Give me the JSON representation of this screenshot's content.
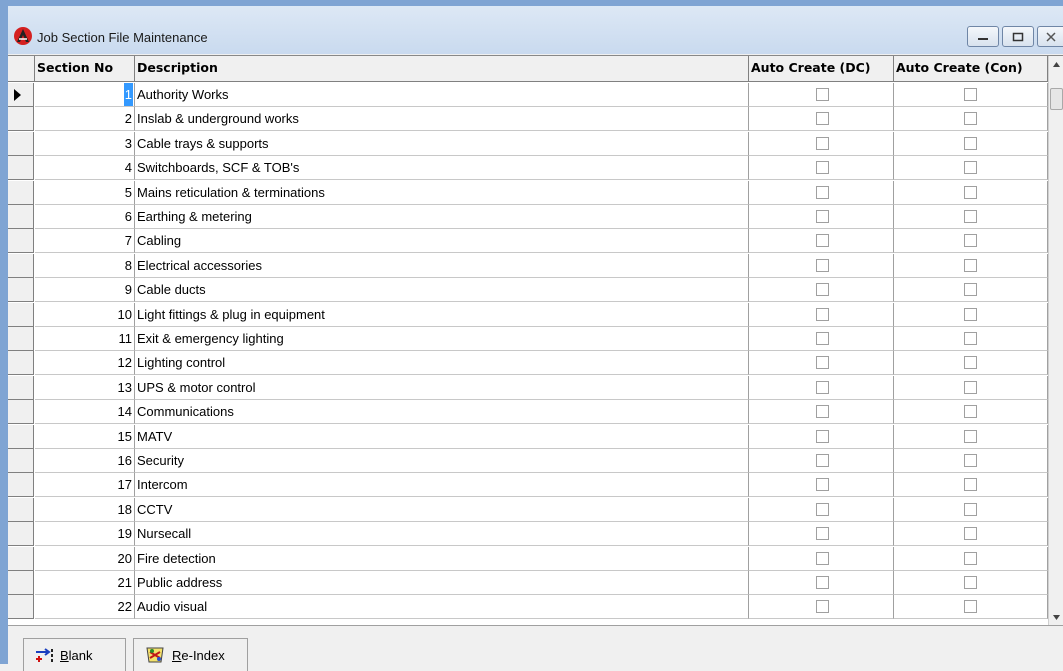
{
  "window": {
    "title": "Job Section File Maintenance"
  },
  "grid": {
    "columns": {
      "section_no": "Section No",
      "description": "Description",
      "auto_dc": "Auto Create (DC)",
      "auto_con": "Auto Create (Con)"
    },
    "rows": [
      {
        "no": "1",
        "desc": "Authority Works",
        "dc": false,
        "con": false
      },
      {
        "no": "2",
        "desc": "Inslab & underground works",
        "dc": false,
        "con": false
      },
      {
        "no": "3",
        "desc": "Cable trays & supports",
        "dc": false,
        "con": false
      },
      {
        "no": "4",
        "desc": "Switchboards, SCF & TOB's",
        "dc": false,
        "con": false
      },
      {
        "no": "5",
        "desc": " Mains reticulation & terminations",
        "dc": false,
        "con": false
      },
      {
        "no": "6",
        "desc": "Earthing & metering",
        "dc": false,
        "con": false
      },
      {
        "no": "7",
        "desc": "Cabling",
        "dc": false,
        "con": false
      },
      {
        "no": "8",
        "desc": "Electrical accessories",
        "dc": false,
        "con": false
      },
      {
        "no": "9",
        "desc": "Cable ducts",
        "dc": false,
        "con": false
      },
      {
        "no": "10",
        "desc": "Light fittings & plug in equipment",
        "dc": false,
        "con": false
      },
      {
        "no": "11",
        "desc": "Exit & emergency lighting",
        "dc": false,
        "con": false
      },
      {
        "no": "12",
        "desc": "Lighting control",
        "dc": false,
        "con": false
      },
      {
        "no": "13",
        "desc": "UPS & motor control",
        "dc": false,
        "con": false
      },
      {
        "no": "14",
        "desc": "Communications",
        "dc": false,
        "con": false
      },
      {
        "no": "15",
        "desc": "MATV",
        "dc": false,
        "con": false
      },
      {
        "no": "16",
        "desc": "Security",
        "dc": false,
        "con": false
      },
      {
        "no": "17",
        "desc": "Intercom",
        "dc": false,
        "con": false
      },
      {
        "no": "18",
        "desc": "CCTV",
        "dc": false,
        "con": false
      },
      {
        "no": "19",
        "desc": "Nursecall",
        "dc": false,
        "con": false
      },
      {
        "no": "20",
        "desc": "Fire detection",
        "dc": false,
        "con": false
      },
      {
        "no": "21",
        "desc": "Public address",
        "dc": false,
        "con": false
      },
      {
        "no": "22",
        "desc": "Audio visual",
        "dc": false,
        "con": false
      }
    ],
    "selected_row": 0
  },
  "toolbar": {
    "blank_label": "Blank",
    "blank_icon": "blank-icon",
    "reindex_label": "Re-Index",
    "reindex_icon": "reindex-icon"
  },
  "colors": {
    "selection": "#3399ff",
    "frame": "#7fa4d3"
  }
}
